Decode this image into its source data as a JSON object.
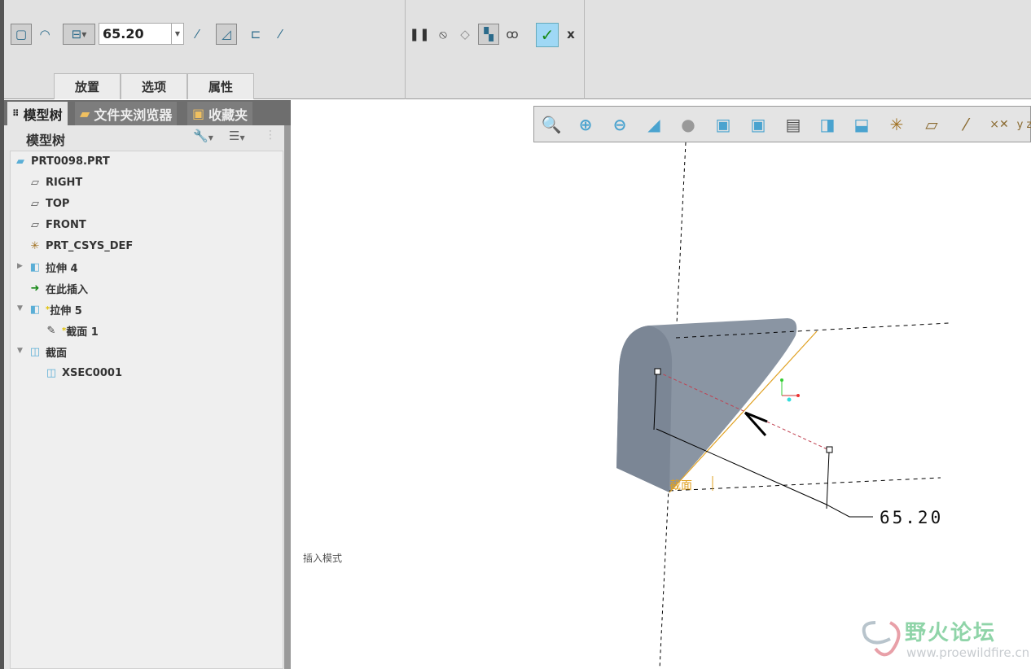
{
  "ribbon": {
    "depth_value": "65.20",
    "tabs": [
      "放置",
      "选项",
      "属性"
    ],
    "icons_left": [
      "solid-icon",
      "surface-icon",
      "depth-option-icon",
      "flip-direction-icon",
      "remove-material-icon",
      "thicken-icon",
      "flip-thicken-icon"
    ],
    "icons_right": [
      "pause-icon",
      "no-preview-icon",
      "verify-geometry-icon",
      "preview-icon",
      "glasses-icon"
    ],
    "ok_icon": "checkmark-icon",
    "cancel_label": "x"
  },
  "panel": {
    "tabs": [
      "模型树",
      "文件夹浏览器",
      "收藏夹"
    ],
    "header": "模型树",
    "tree": [
      {
        "label": "PRT0098.PRT",
        "icon": "part-icon"
      },
      {
        "label": "RIGHT",
        "icon": "datum-plane-icon"
      },
      {
        "label": "TOP",
        "icon": "datum-plane-icon"
      },
      {
        "label": "FRONT",
        "icon": "datum-plane-icon"
      },
      {
        "label": "PRT_CSYS_DEF",
        "icon": "csys-icon"
      },
      {
        "label": "拉伸 4",
        "icon": "extrude-icon",
        "expander": "▶"
      },
      {
        "label": "在此插入",
        "icon": "insert-arrow-icon"
      },
      {
        "label": "拉伸 5",
        "icon": "extrude-icon",
        "expander": "▼",
        "marker": "*"
      },
      {
        "label": "截面 1",
        "icon": "sketch-icon",
        "marker": "*"
      },
      {
        "label": "截面",
        "icon": "section-icon",
        "expander": "▼"
      },
      {
        "label": "XSEC0001",
        "icon": "section-icon"
      }
    ]
  },
  "view_toolbar": [
    "refit-icon",
    "zoom-in-icon",
    "zoom-out-icon",
    "repaint-icon",
    "display-style-icon",
    "saved-views-icon",
    "view-manager-icon",
    "perspective-icon",
    "section-view-icon",
    "orient-icon",
    "datum-display-icon",
    "plane-display-icon",
    "axis-display-icon",
    "point-display-icon",
    "csys-display-icon"
  ],
  "viewport": {
    "dimension": "65.20",
    "section_label": "截面",
    "mode_label": "插入模式",
    "colors": {
      "solid": "#8a95a3",
      "edge": "#e0a020",
      "dim_line": "#c04050"
    }
  },
  "watermark": {
    "title": "野火论坛",
    "url": "www.proewildfire.cn"
  }
}
